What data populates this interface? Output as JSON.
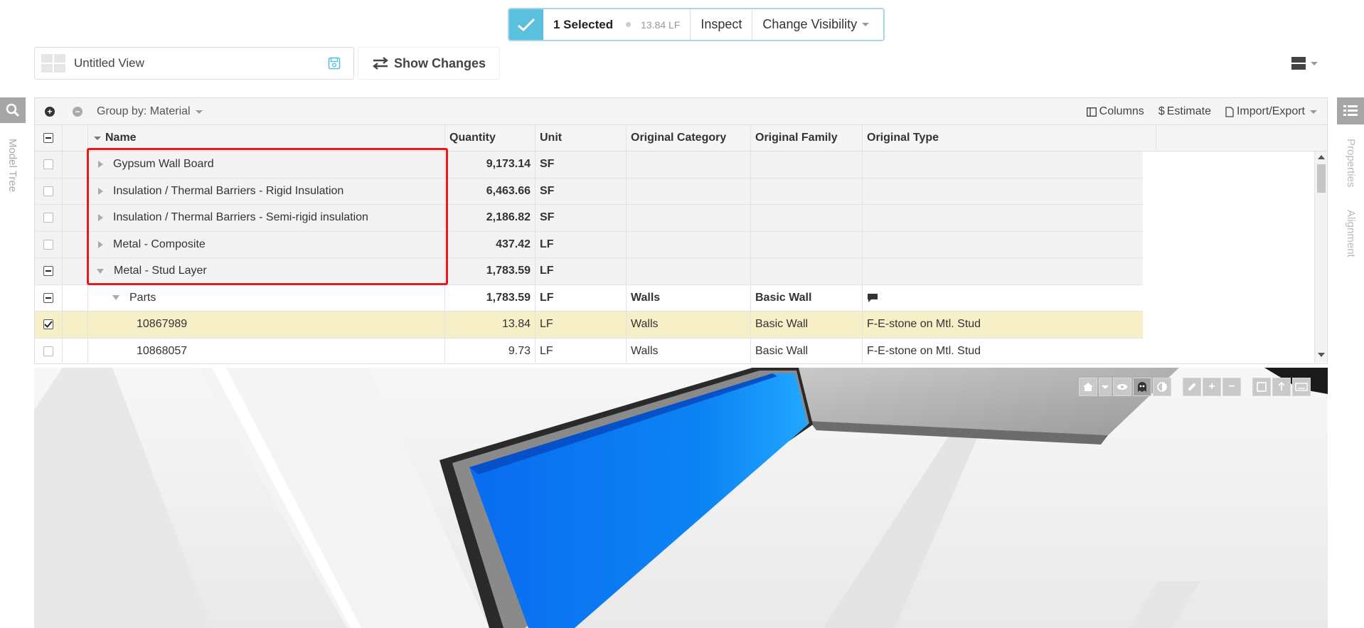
{
  "selection_bar": {
    "count_label": "1 Selected",
    "measure": "13.84 LF",
    "inspect_label": "Inspect",
    "visibility_label": "Change Visibility"
  },
  "view": {
    "name": "Untitled View",
    "show_changes_label": "Show Changes"
  },
  "left_rail": {
    "model_tree_label": "Model Tree"
  },
  "right_rail": {
    "properties_label": "Properties",
    "alignment_label": "Alignment"
  },
  "grid_toolbar": {
    "group_by_label": "Group by: Material",
    "columns_label": "Columns",
    "estimate_label": "Estimate",
    "import_export_label": "Import/Export"
  },
  "columns": {
    "name": "Name",
    "quantity": "Quantity",
    "unit": "Unit",
    "category": "Original Category",
    "family": "Original Family",
    "type": "Original Type"
  },
  "rows": [
    {
      "name": "Gypsum Wall Board",
      "quantity": "9,173.14",
      "unit": "SF",
      "category": "",
      "family": "",
      "type": ""
    },
    {
      "name": "Insulation / Thermal Barriers - Rigid Insulation",
      "quantity": "6,463.66",
      "unit": "SF",
      "category": "",
      "family": "",
      "type": ""
    },
    {
      "name": "Insulation / Thermal Barriers - Semi-rigid insulation",
      "quantity": "2,186.82",
      "unit": "SF",
      "category": "",
      "family": "",
      "type": ""
    },
    {
      "name": "Metal - Composite",
      "quantity": "437.42",
      "unit": "LF",
      "category": "",
      "family": "",
      "type": ""
    },
    {
      "name": "Metal - Stud Layer",
      "quantity": "1,783.59",
      "unit": "LF",
      "category": "",
      "family": "",
      "type": ""
    },
    {
      "name": "Parts",
      "quantity": "1,783.59",
      "unit": "LF",
      "category": "Walls",
      "family": "Basic Wall",
      "type": ""
    },
    {
      "name": "10867989",
      "quantity": "13.84",
      "unit": "LF",
      "category": "Walls",
      "family": "Basic Wall",
      "type": "F-E-stone on Mtl. Stud"
    },
    {
      "name": "10868057",
      "quantity": "9.73",
      "unit": "LF",
      "category": "Walls",
      "family": "Basic Wall",
      "type": "F-E-stone on Mtl. Stud"
    }
  ],
  "colors": {
    "accent": "#5bc0de",
    "selected_row": "#f7efc8",
    "highlight": "#e8191c",
    "model_blue": "#0a6cf0"
  }
}
